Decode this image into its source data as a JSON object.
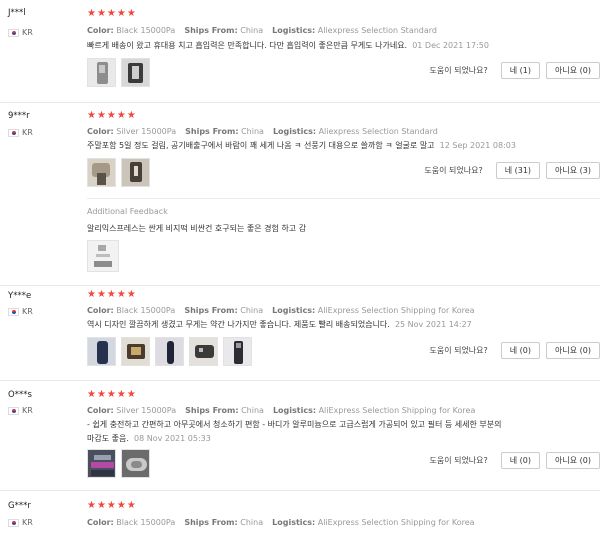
{
  "reviews": [
    {
      "name": "J***l",
      "country": "KR",
      "stars": "★★★★★",
      "color_label": "Color:",
      "color": "Black 15000Pa",
      "ships_label": "Ships From:",
      "ships": "China",
      "log_label": "Logistics:",
      "logistics": "Aliexpress Selection Standard",
      "text": "빠르게 배송이 왔고 휴대용 치고 흡입력은 만족합니다. 다만 흡입력이 좋은만큼 무게도 나가네요.",
      "date": "01 Dec 2021 17:50",
      "helpful_q": "도움이 되었나요?",
      "yes": "네 (1)",
      "no": "아니요 (0)"
    },
    {
      "name": "9***r",
      "country": "KR",
      "stars": "★★★★★",
      "color_label": "Color:",
      "color": "Silver 15000Pa",
      "ships_label": "Ships From:",
      "ships": "China",
      "log_label": "Logistics:",
      "logistics": "Aliexpress Selection Standard",
      "text": "주말포함 5일 정도 걸림, 공기배출구에서 바람이 꽤 세게 나옴 ㅋ 선풍기 대용으로 쓸까함 ㅋ 얼굴로 말고",
      "date": "12 Sep 2021 08:03",
      "helpful_q": "도움이 되었나요?",
      "yes": "네 (31)",
      "no": "아니요 (3)",
      "additional_title": "Additional Feedback",
      "additional_text": "알리익스프레스는 싼게 비지떡 비싼건 호구되는 좋은 경험 하고 감"
    },
    {
      "name": "Y***e",
      "country": "KR",
      "stars": "★★★★★",
      "color_label": "Color:",
      "color": "Black 15000Pa",
      "ships_label": "Ships From:",
      "ships": "China",
      "log_label": "Logistics:",
      "logistics": "AliExpress Selection Shipping for Korea",
      "text": "역시 디자인 깔끔하게 생겼고 무게는 약간 나가지만 좋습니다. 제품도 빨리 배송되었습니다.",
      "date": "25 Nov 2021 14:27",
      "helpful_q": "도움이 되었나요?",
      "yes": "네 (0)",
      "no": "아니요 (0)"
    },
    {
      "name": "O***s",
      "country": "KR",
      "stars": "★★★★★",
      "color_label": "Color:",
      "color": "Silver 15000Pa",
      "ships_label": "Ships From:",
      "ships": "China",
      "log_label": "Logistics:",
      "logistics": "AliExpress Selection Shipping for Korea",
      "text": "- 쉽게 충전하고 간편하고 아무곳에서 청소하기 편함 - 바디가 알루미늄으로 고급스럽게 가공되어 있고 필터 등 세세한 부분의",
      "text2": "마감도 좋음.",
      "date": "08 Nov 2021 05:33",
      "helpful_q": "도움이 되었나요?",
      "yes": "네 (0)",
      "no": "아니요 (0)"
    },
    {
      "name": "G***r",
      "country": "KR",
      "stars": "★★★★★",
      "color_label": "Color:",
      "color": "Black 15000Pa",
      "ships_label": "Ships From:",
      "ships": "China",
      "log_label": "Logistics:",
      "logistics": "AliExpress Selection Shipping for Korea"
    }
  ]
}
